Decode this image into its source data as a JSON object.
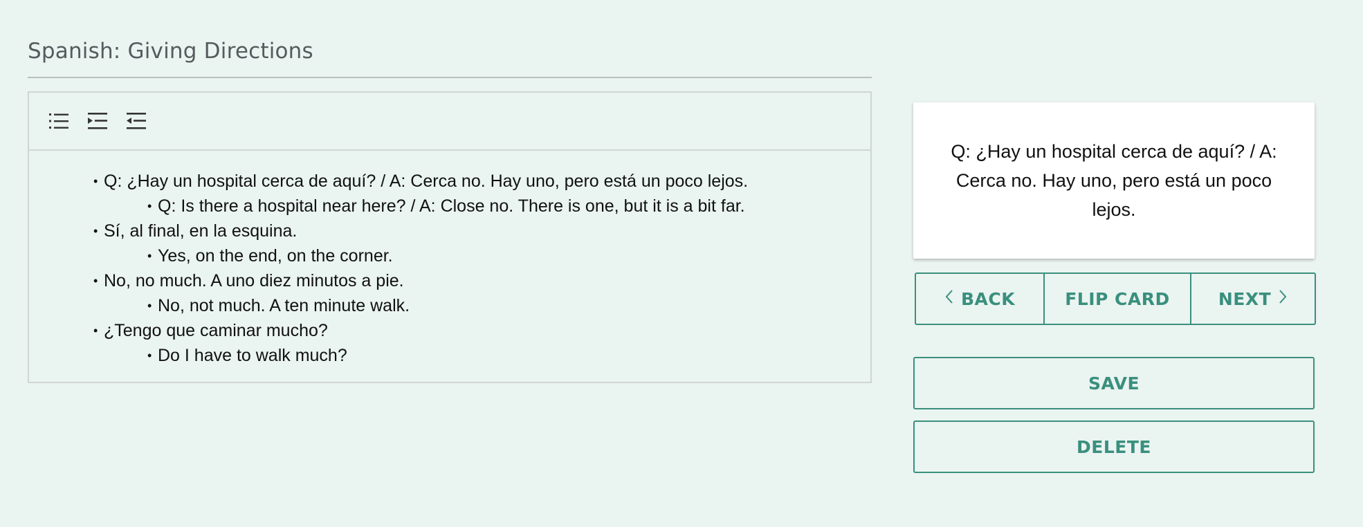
{
  "deck": {
    "title": "Spanish: Giving Directions"
  },
  "toolbar": {
    "bullet_list_icon": "bulleted-list-icon",
    "indent_icon": "indent-icon",
    "outdent_icon": "outdent-icon"
  },
  "editor": {
    "lines": [
      {
        "level": 1,
        "text": "Q: ¿Hay un hospital cerca de aquí? / A: Cerca no. Hay uno, pero está un poco lejos."
      },
      {
        "level": 2,
        "text": "Q: Is there a hospital near here? / A: Close no. There is one, but it is a bit far."
      },
      {
        "level": 1,
        "text": "Sí, al final, en la esquina."
      },
      {
        "level": 2,
        "text": "Yes, on the end, on the corner."
      },
      {
        "level": 1,
        "text": "No, no much. A uno diez minutos a pie."
      },
      {
        "level": 2,
        "text": "No, not much. A ten minute walk."
      },
      {
        "level": 1,
        "text": "¿Tengo que caminar mucho?"
      },
      {
        "level": 2,
        "text": "Do I have to walk much?"
      }
    ]
  },
  "card": {
    "text": "Q: ¿Hay un hospital cerca de aquí? / A: Cerca no. Hay uno, pero está un poco lejos."
  },
  "nav": {
    "back_label": "BACK",
    "flip_label": "FLIP CARD",
    "next_label": "NEXT",
    "back_icon": "chevron-left-icon",
    "next_icon": "chevron-right-icon"
  },
  "actions": {
    "save_label": "SAVE",
    "delete_label": "DELETE"
  },
  "colors": {
    "background": "#eaf4f0",
    "accent": "#3a8f7e",
    "card": "#ffffff"
  }
}
